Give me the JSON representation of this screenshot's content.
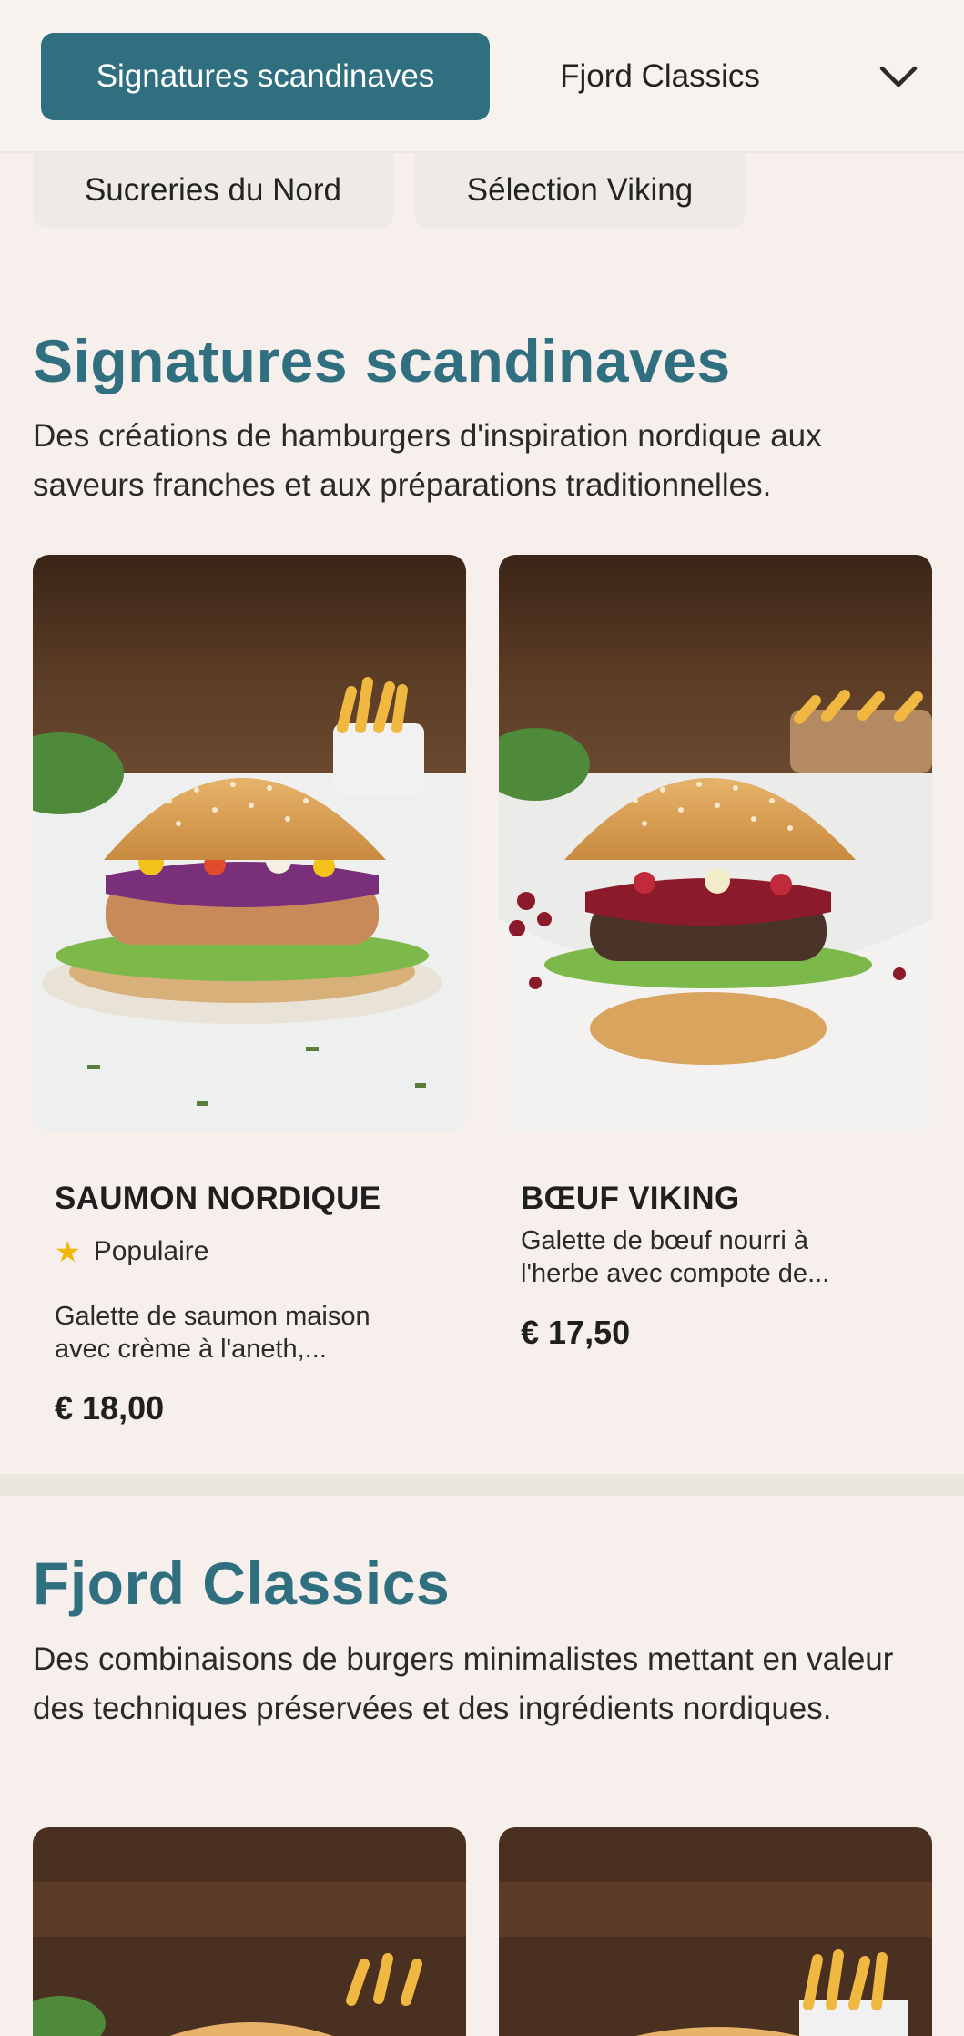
{
  "tabs": {
    "row1": [
      "Signatures scandinaves",
      "Fjord Classics"
    ],
    "row2": [
      "Sucreries du Nord",
      "Sélection Viking"
    ]
  },
  "sections": [
    {
      "title": "Signatures scandinaves",
      "description": "Des créations de hamburgers d'inspiration nordique aux saveurs franches et aux préparations traditionnelles.",
      "items": [
        {
          "name": "SAUMON NORDIQUE",
          "badge": "Populaire",
          "description": "Galette de saumon maison avec crème à l'aneth,...",
          "price": "€ 18,00"
        },
        {
          "name": "BŒUF VIKING",
          "description": "Galette de bœuf nourri à l'herbe avec compote de...",
          "price": "€ 17,50"
        }
      ]
    },
    {
      "title": "Fjord Classics",
      "description": "Des combinaisons de burgers minimalistes mettant en valeur des techniques préservées et des ingrédients nordiques."
    }
  ],
  "colors": {
    "accent": "#2f6f80",
    "background": "#f6efeb",
    "star": "#f2b705"
  },
  "icons": [
    "chevron-down-icon",
    "star-icon"
  ]
}
